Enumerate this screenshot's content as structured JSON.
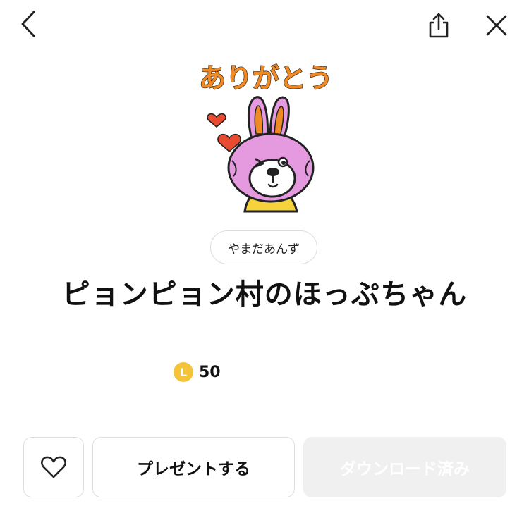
{
  "header": {
    "back_icon": "chevron-left-icon",
    "share_icon": "share-icon",
    "close_icon": "close-icon"
  },
  "sticker": {
    "caption": "ありがとう",
    "colors": {
      "caption": "#f08a24",
      "rabbit": "#e59ae0",
      "heart": "#e84b2f",
      "shirt": "#f5d33c"
    }
  },
  "author": {
    "label": "やまだあんず"
  },
  "product": {
    "title": "ピョンピョン村のほっぷちゃん",
    "coin_symbol": "L",
    "price": "50"
  },
  "actions": {
    "like_icon": "heart-outline-icon",
    "present_label": "プレゼントする",
    "download_label": "ダウンロード済み"
  },
  "colors": {
    "coin": "#f3c43a",
    "disabled_bg": "#f0f0f0",
    "border": "#dedede"
  }
}
